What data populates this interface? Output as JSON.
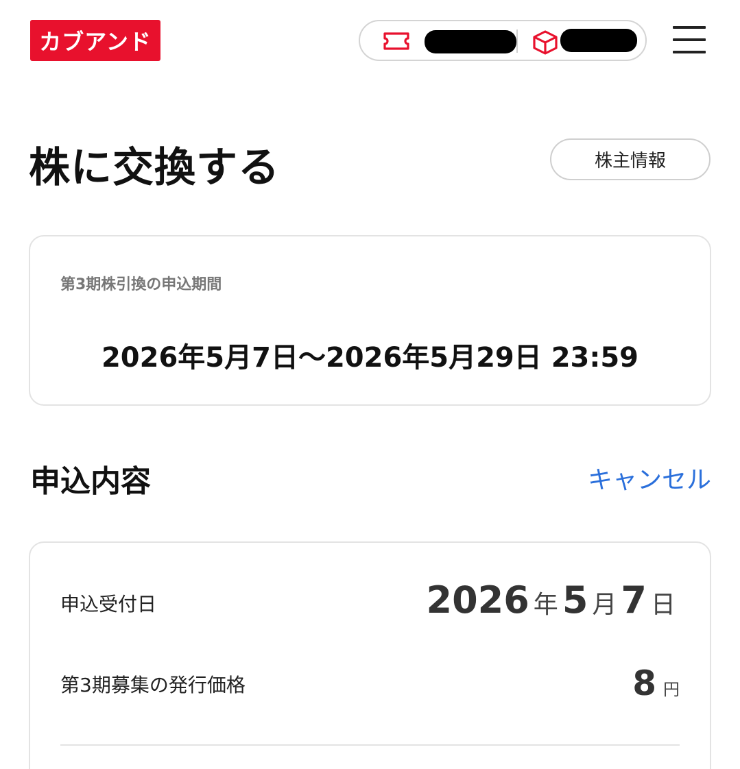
{
  "header": {
    "logo_text": "カブアンド",
    "logo_color": "#e8112d",
    "ticket_icon": "ticket-icon",
    "box_icon": "box-icon",
    "menu_icon": "hamburger-menu-icon"
  },
  "title": {
    "text": "株に交換する",
    "shareholder_button": "株主情報"
  },
  "period": {
    "label": "第3期株引換の申込期間",
    "value": "2026年5月7日〜2026年5月29日 23:59"
  },
  "application": {
    "heading": "申込内容",
    "cancel_label": "キャンセル",
    "accept_date_label": "申込受付日",
    "date": {
      "year": "2026",
      "year_unit": "年",
      "month": "5",
      "month_unit": "月",
      "day": "7",
      "day_unit": "日"
    },
    "price_label": "第3期募集の発行価格",
    "price": "8",
    "price_unit": "円"
  },
  "colors": {
    "accent_red": "#e8112d",
    "link_blue": "#2a6fdb"
  }
}
